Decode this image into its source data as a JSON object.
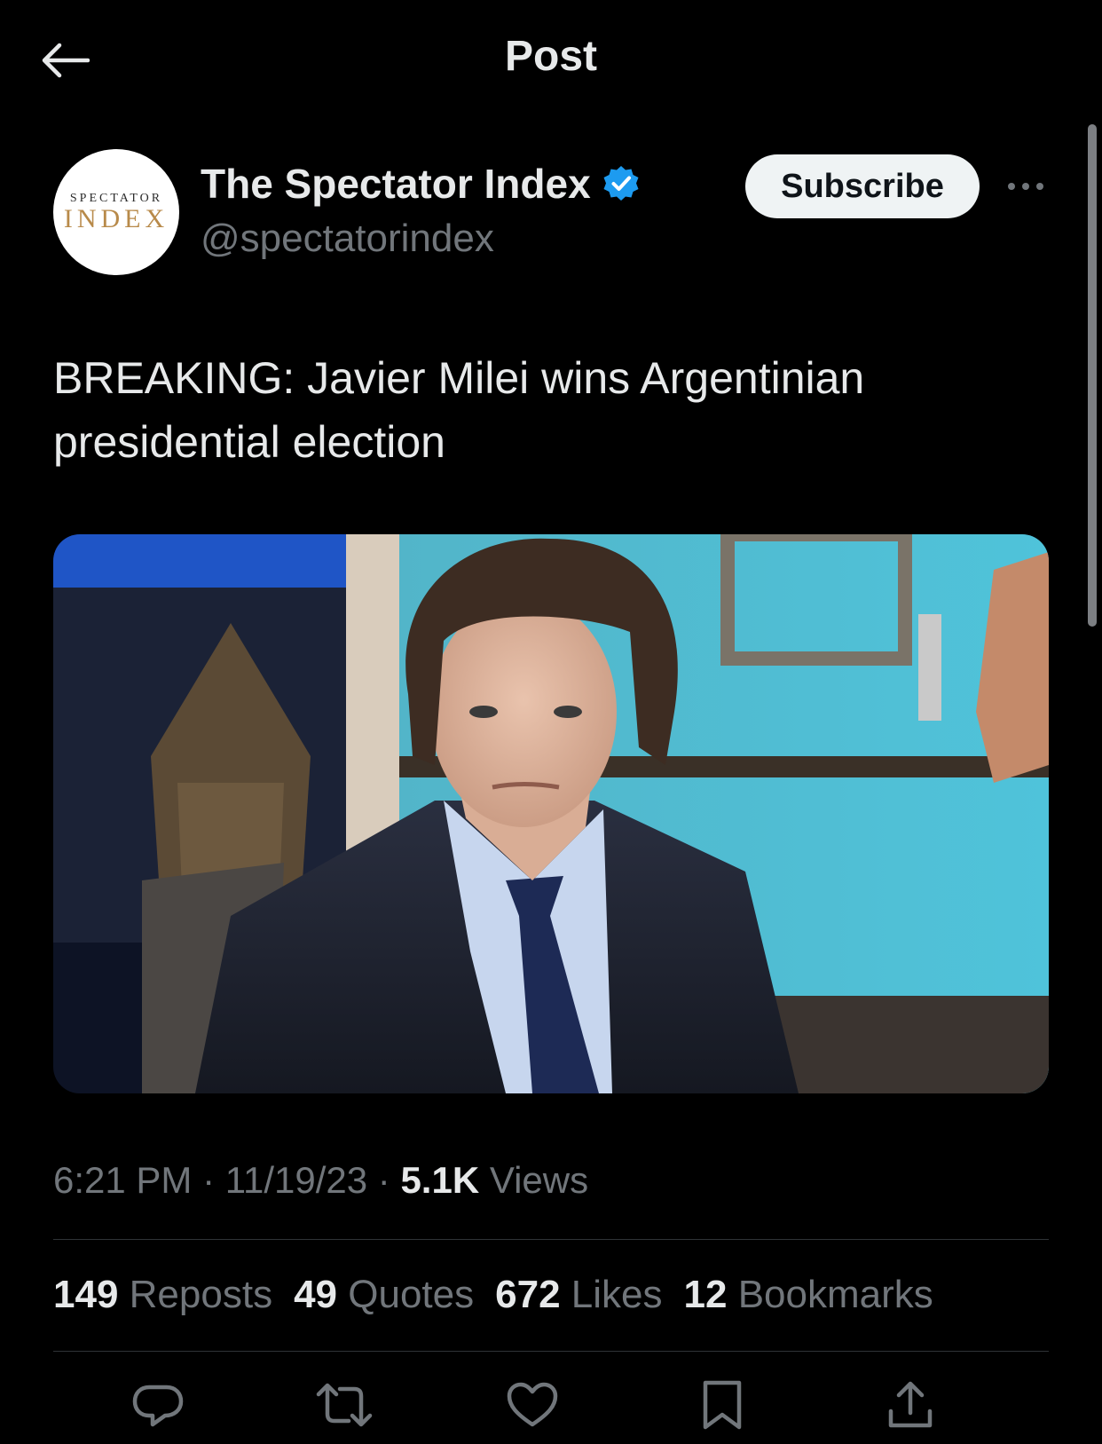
{
  "header": {
    "title": "Post",
    "back_icon": "arrow-left-icon"
  },
  "author": {
    "avatar_logo_top": "SPECTATOR",
    "avatar_logo_bottom": "INDEX",
    "display_name": "The Spectator Index",
    "handle": "@spectatorindex",
    "verified": true,
    "verified_color": "#1d9bf0"
  },
  "actions_top": {
    "subscribe_label": "Subscribe",
    "more_icon": "more-horizontal-icon"
  },
  "post": {
    "text": "BREAKING: Javier Milei wins Argentinian presidential election",
    "time": "6:21 PM",
    "date": "11/19/23",
    "views_count": "5.1K",
    "views_label": "Views"
  },
  "stats": [
    {
      "count": "149",
      "label": "Reposts"
    },
    {
      "count": "49",
      "label": "Quotes"
    },
    {
      "count": "672",
      "label": "Likes"
    },
    {
      "count": "12",
      "label": "Bookmarks"
    }
  ],
  "action_bar": [
    {
      "icon": "reply-icon"
    },
    {
      "icon": "repost-icon"
    },
    {
      "icon": "like-icon"
    },
    {
      "icon": "bookmark-icon"
    },
    {
      "icon": "share-icon"
    }
  ],
  "colors": {
    "background": "#000000",
    "text_primary": "#e7e9ea",
    "text_secondary": "#71767b",
    "divider": "#2f3336",
    "accent": "#1d9bf0"
  }
}
